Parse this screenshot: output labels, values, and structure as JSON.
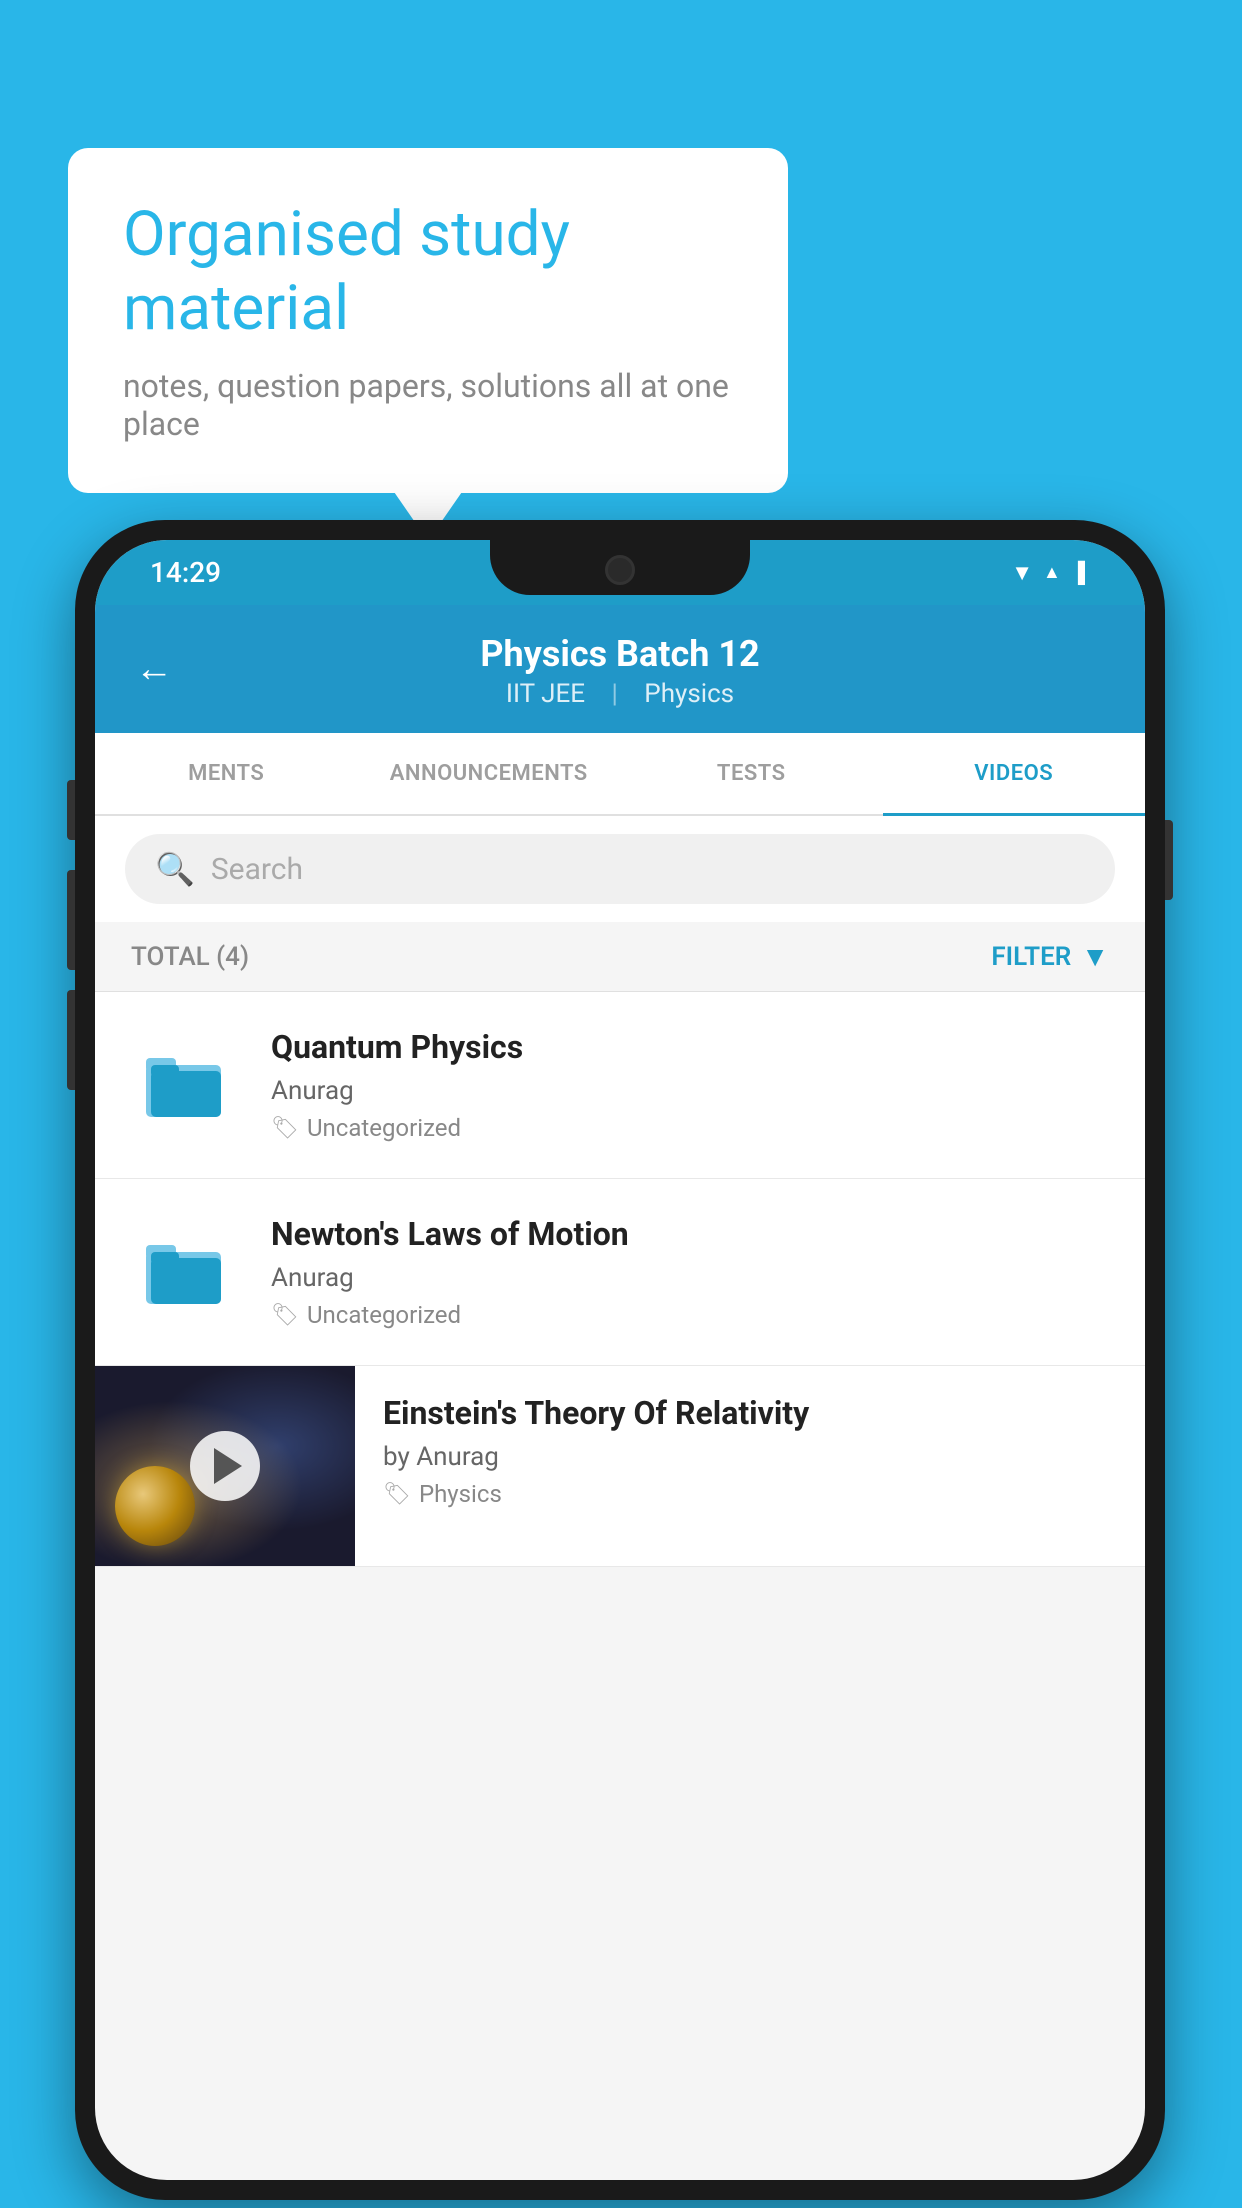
{
  "background_color": "#29b6e8",
  "speech_bubble": {
    "title": "Organised study material",
    "subtitle": "notes, question papers, solutions all at one place"
  },
  "phone": {
    "status_bar": {
      "time": "14:29",
      "icons": [
        "wifi",
        "signal",
        "battery"
      ]
    },
    "header": {
      "back_label": "←",
      "title": "Physics Batch 12",
      "subtitle_part1": "IIT JEE",
      "subtitle_part2": "Physics"
    },
    "tabs": [
      {
        "label": "MENTS",
        "active": false
      },
      {
        "label": "ANNOUNCEMENTS",
        "active": false
      },
      {
        "label": "TESTS",
        "active": false
      },
      {
        "label": "VIDEOS",
        "active": true
      }
    ],
    "search": {
      "placeholder": "Search"
    },
    "filter_bar": {
      "total_label": "TOTAL (4)",
      "filter_label": "FILTER"
    },
    "videos": [
      {
        "id": 1,
        "title": "Quantum Physics",
        "author": "Anurag",
        "tag": "Uncategorized",
        "type": "folder"
      },
      {
        "id": 2,
        "title": "Newton's Laws of Motion",
        "author": "Anurag",
        "tag": "Uncategorized",
        "type": "folder"
      },
      {
        "id": 3,
        "title": "Einstein's Theory Of Relativity",
        "author": "by Anurag",
        "tag": "Physics",
        "type": "thumbnail"
      }
    ]
  }
}
